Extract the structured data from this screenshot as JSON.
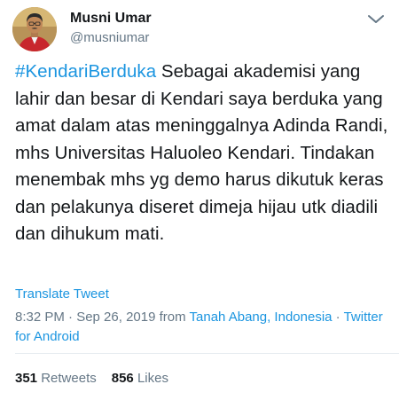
{
  "user": {
    "display_name": "Musni Umar",
    "handle": "@musniumar"
  },
  "tweet": {
    "hashtag": "#KendariBerduka",
    "text": " Sebagai akademisi yang lahir dan besar di Kendari saya berduka yang amat dalam atas meninggalnya Adinda Randi, mhs Universitas Haluoleo Kendari. Tindakan menembak mhs yg demo harus dikutuk keras dan pelakunya diseret dimeja hijau utk diadili dan dihukum mati.",
    "translate_label": "Translate Tweet",
    "time": "8:32 PM · Sep 26, 2019 from ",
    "location": "Tanah Abang, Indonesia",
    "separator": " · ",
    "source": "Twitter for Android"
  },
  "stats": {
    "retweets_count": "351",
    "retweets_label": "Retweets",
    "likes_count": "856",
    "likes_label": "Likes"
  },
  "icons": {
    "more": "chevron-down-icon",
    "avatar": "avatar"
  },
  "colors": {
    "link": "#1b95e0",
    "text": "#14171a",
    "secondary": "#657786",
    "divider": "#e6ecf0"
  }
}
